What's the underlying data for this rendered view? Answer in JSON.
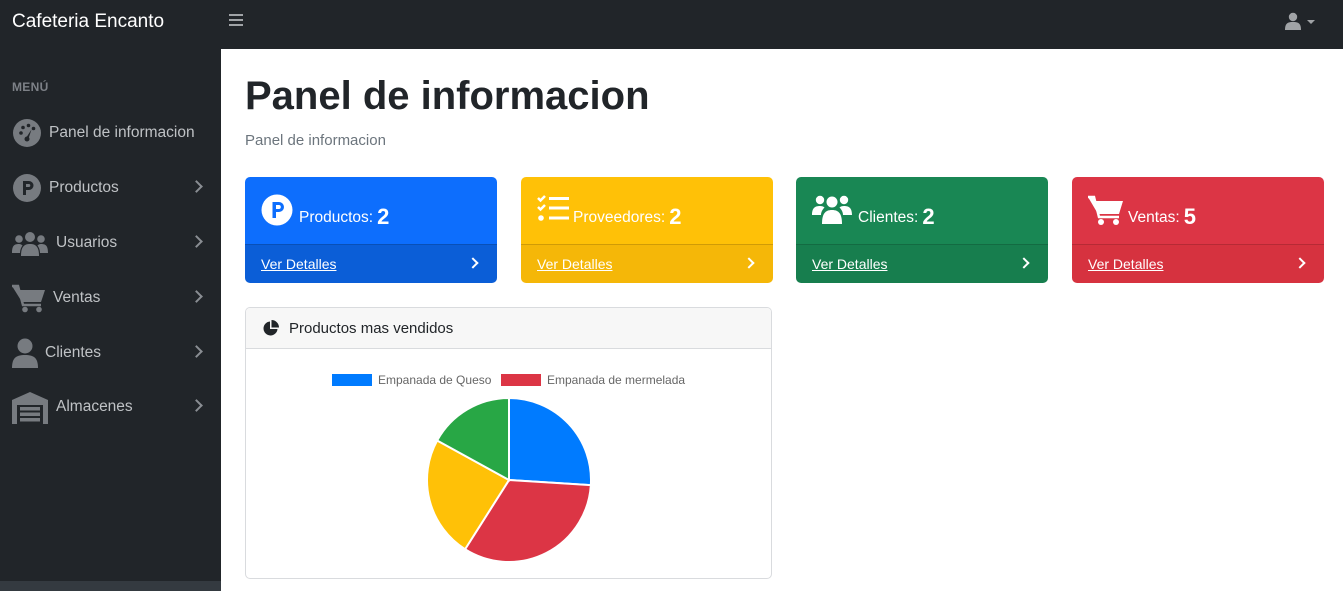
{
  "app": {
    "brand": "Cafeteria Encanto"
  },
  "sidebar": {
    "heading": "MENÚ",
    "items": [
      {
        "label": "Panel de informacion",
        "icon": "tachometer-icon",
        "has_submenu": false
      },
      {
        "label": "Productos",
        "icon": "parking-circle-icon",
        "has_submenu": true
      },
      {
        "label": "Usuarios",
        "icon": "users-icon",
        "has_submenu": true
      },
      {
        "label": "Ventas",
        "icon": "shopping-cart-icon",
        "has_submenu": true
      },
      {
        "label": "Clientes",
        "icon": "user-icon",
        "has_submenu": true
      },
      {
        "label": "Almacenes",
        "icon": "warehouse-icon",
        "has_submenu": true
      }
    ]
  },
  "main": {
    "title": "Panel de informacion",
    "breadcrumb": "Panel de informacion",
    "cards": [
      {
        "label": "Productos:",
        "count": "2",
        "link": "Ver Detalles",
        "color": "#0d6efd",
        "footer_color": "#0b5ed7",
        "icon": "parking-circle-icon"
      },
      {
        "label": "Proveedores:",
        "count": "2",
        "link": "Ver Detalles",
        "color": "#ffc107",
        "footer_color": "#f5b708",
        "icon": "tasks-list-icon"
      },
      {
        "label": "Clientes:",
        "count": "2",
        "link": "Ver Detalles",
        "color": "#198754",
        "footer_color": "#177e4e",
        "icon": "users-icon"
      },
      {
        "label": "Ventas:",
        "count": "5",
        "link": "Ver Detalles",
        "color": "#dc3545",
        "footer_color": "#d6323f",
        "icon": "shopping-cart-icon"
      }
    ]
  },
  "chart_panel": {
    "title": "Productos mas vendidos",
    "icon": "chart-pie-icon"
  },
  "chart_data": {
    "type": "pie",
    "legend": [
      "Empanada de Queso",
      "Empanada de mermelada"
    ],
    "values": [
      26,
      33,
      24,
      17
    ],
    "colors": [
      "#007bff",
      "#dc3545",
      "#ffc107",
      "#28a745"
    ],
    "legend_placement": "top"
  }
}
